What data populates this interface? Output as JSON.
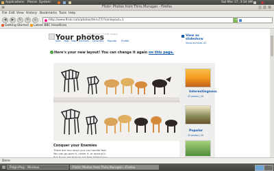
{
  "top_panel": {
    "menus": [
      "Applications",
      "Places",
      "System"
    ],
    "clock": "Sat Mar 17,  3:34 AM"
  },
  "window": {
    "title": "Flickr: Photos from Thiru Murugan - Firefox"
  },
  "menubar": [
    "File",
    "Edit",
    "View",
    "History",
    "Bookmarks",
    "Tools",
    "Help"
  ],
  "navbar": {
    "url": "http://www.flickr.com/photos/thiru77/?sanlayout=1"
  },
  "bookmarks": [
    "Getting Started",
    "Latest BBC Headlines"
  ],
  "page": {
    "title": "Your photos",
    "stats": "(16 photos | 3,448 views)",
    "tabs": [
      "Sets",
      "Tags",
      "Map",
      "Archives",
      "Favorites",
      "Popular",
      "Profile"
    ],
    "slideshow": {
      "title": "View as slideshow",
      "subtitle": "Show archives #1"
    },
    "notice": {
      "text": "Here's your new layout! You can change it again",
      "link": "on this page."
    },
    "photo": {
      "title": "Conquer your Enemies",
      "description": [
        "There are four ways you can handle fear.",
        "You can go over it, under it, or around it.",
        "But if you are ever to put fear behind you,",
        "you must walk right through it."
      ]
    },
    "sidebar": [
      {
        "label": "Interestingness",
        "count": "25 photos | 50"
      },
      {
        "label": "Popular",
        "count": "25 photos | 50"
      }
    ]
  },
  "statusbar": {
    "text": "Done"
  },
  "taskbar": {
    "tasks": [
      "PidginMsg - Window",
      "Flickr: Photos from Thiru Murugan - Firefox"
    ]
  },
  "colors": {
    "link": "#1057ae",
    "panel": "#4b4d49",
    "chrome": "#ecebe7"
  }
}
